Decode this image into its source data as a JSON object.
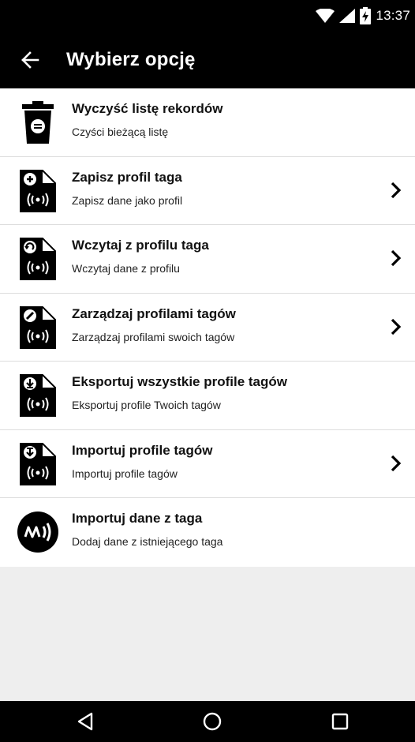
{
  "status_bar": {
    "time": "13:37",
    "icons": [
      "wifi-icon",
      "signal-icon",
      "battery-charging-icon"
    ]
  },
  "app_bar": {
    "title": "Wybierz opcję",
    "back_icon": "arrow-left-icon"
  },
  "menu": {
    "items": [
      {
        "title": "Wyczyść listę rekordów",
        "subtitle": "Czyści bieżącą listę",
        "icon": "trash-icon",
        "has_chevron": false
      },
      {
        "title": "Zapisz profil taga",
        "subtitle": "Zapisz dane jako profil",
        "icon": "tag-profile-add-icon",
        "has_chevron": true
      },
      {
        "title": "Wczytaj z profilu taga",
        "subtitle": "Wczytaj dane z profilu",
        "icon": "tag-profile-load-icon",
        "has_chevron": true
      },
      {
        "title": "Zarządzaj profilami tagów",
        "subtitle": "Zarządzaj profilami swoich tagów",
        "icon": "tag-profile-edit-icon",
        "has_chevron": true
      },
      {
        "title": "Eksportuj wszystkie profile tagów",
        "subtitle": "Eksportuj profile Twoich tagów",
        "icon": "tag-profile-export-icon",
        "has_chevron": false
      },
      {
        "title": "Importuj profile tagów",
        "subtitle": "Importuj profile tagów",
        "icon": "tag-profile-import-icon",
        "has_chevron": true
      },
      {
        "title": "Importuj dane z taga",
        "subtitle": "Dodaj dane z istniejącego taga",
        "icon": "nfc-read-icon",
        "has_chevron": false
      }
    ]
  },
  "nav_bar": {
    "buttons": [
      "back-triangle-icon",
      "home-circle-icon",
      "recents-square-icon"
    ]
  },
  "colors": {
    "bar_background": "#000000",
    "list_background": "#ffffff",
    "page_background": "#eeeeee",
    "divider": "#dddddd"
  }
}
